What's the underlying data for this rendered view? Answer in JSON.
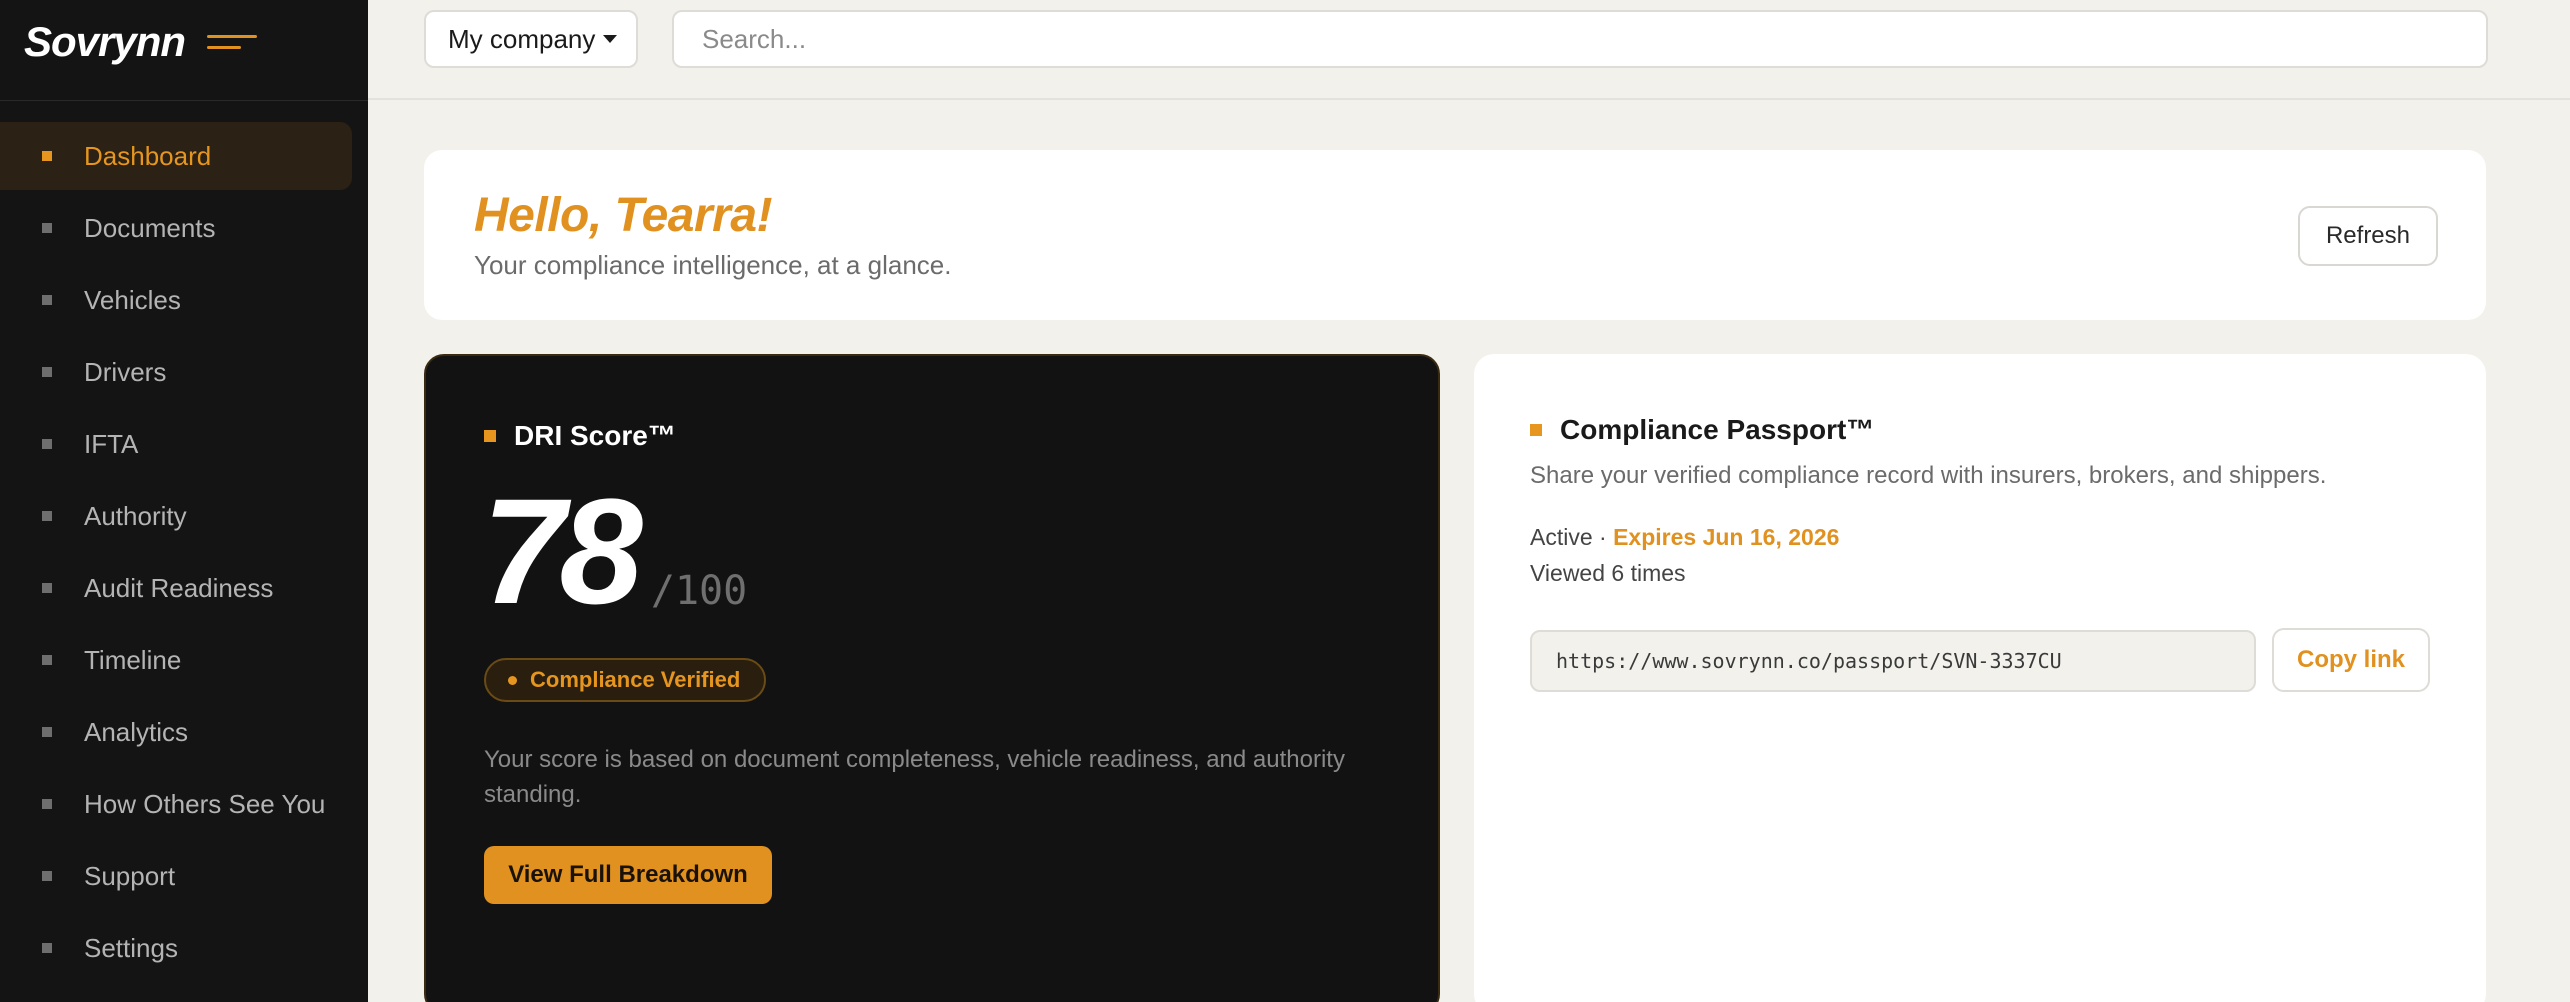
{
  "brand": {
    "name": "Sovrynn",
    "menu_icon": "hamburger-icon",
    "accent": "#e0911f"
  },
  "sidebar": {
    "items": [
      {
        "label": "Dashboard",
        "active": true
      },
      {
        "label": "Documents",
        "active": false
      },
      {
        "label": "Vehicles",
        "active": false
      },
      {
        "label": "Drivers",
        "active": false
      },
      {
        "label": "IFTA",
        "active": false
      },
      {
        "label": "Authority",
        "active": false
      },
      {
        "label": "Audit Readiness",
        "active": false
      },
      {
        "label": "Timeline",
        "active": false
      },
      {
        "label": "Analytics",
        "active": false
      },
      {
        "label": "How Others See You",
        "active": false
      },
      {
        "label": "Support",
        "active": false
      },
      {
        "label": "Settings",
        "active": false
      }
    ]
  },
  "topbar": {
    "company_select": {
      "value": "My company"
    },
    "search": {
      "placeholder": "Search..."
    }
  },
  "greeting": {
    "title": "Hello, Tearra!",
    "subtitle": "Your compliance intelligence, at a glance.",
    "refresh_label": "Refresh"
  },
  "dri": {
    "title": "DRI Score™",
    "score": "78",
    "max": "/100",
    "badge": "Compliance Verified",
    "description": "Your score is based on document completeness, vehicle readiness, and authority standing.",
    "button_label": "View Full Breakdown"
  },
  "passport": {
    "title": "Compliance Passport™",
    "subtitle": "Share your verified compliance record with insurers, brokers, and shippers.",
    "status": "Active",
    "separator": " · ",
    "expires": "Expires Jun 16, 2026",
    "views": "Viewed 6 times",
    "link": "https://www.sovrynn.co/passport/SVN-3337CU",
    "copy_label": "Copy link"
  }
}
